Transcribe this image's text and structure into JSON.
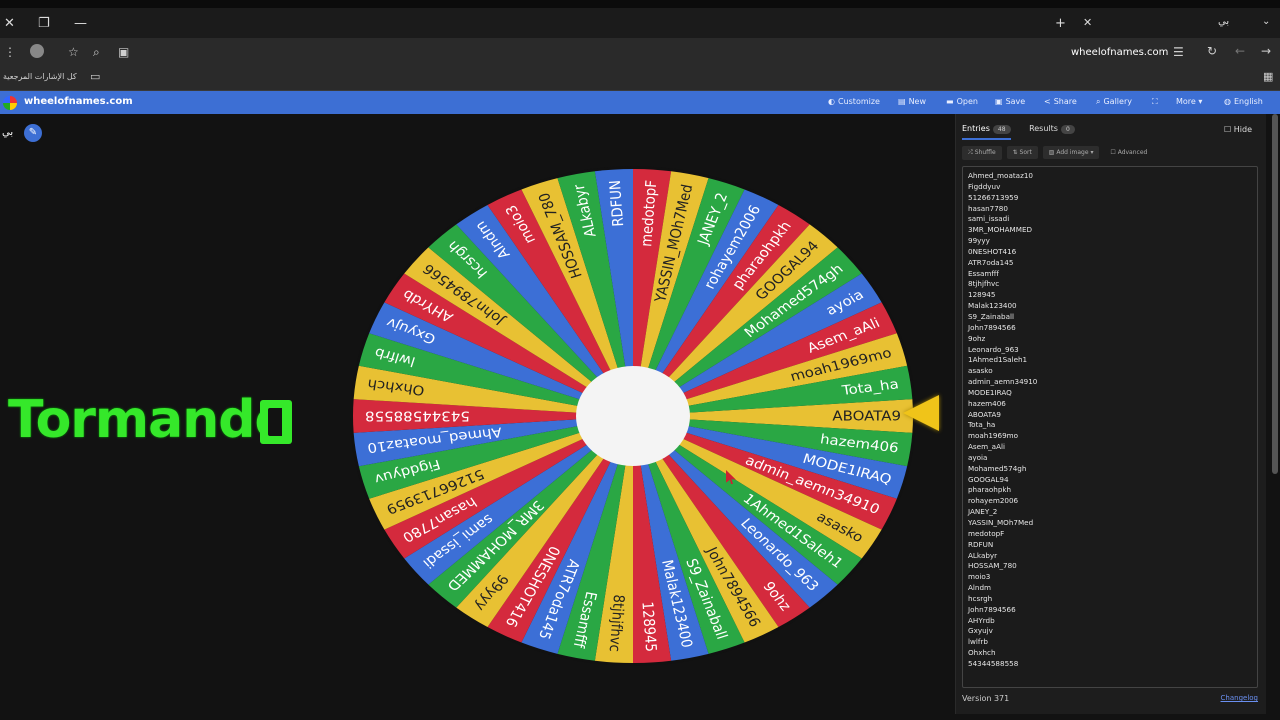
{
  "browser": {
    "url": "wheelofnames.com",
    "tab_title": "بي",
    "bookmarks_label": "كل الإشارات المرجعية"
  },
  "app": {
    "site": "wheelofnames.com",
    "title": "بي",
    "menu": [
      "Customize",
      "New",
      "Open",
      "Save",
      "Share",
      "Gallery",
      "More",
      "English"
    ]
  },
  "overlay": {
    "text": "Tormando"
  },
  "sidebar": {
    "tab_entries": "Entries",
    "entries_count": "48",
    "tab_results": "Results",
    "results_count": "0",
    "hide": "Hide",
    "shuffle": "Shuffle",
    "sort": "Sort",
    "add_image": "Add image",
    "advanced": "Advanced",
    "version": "Version 371",
    "changelog": "Changelog"
  },
  "entries": [
    "Ahmed_moataz10",
    "Figddyuv",
    "51266713959",
    "hasan7780",
    "sami_issadi",
    "3MR_MOHAMMED",
    "99yyy",
    "0NESHOT416",
    "ATR7oda145",
    "Essamfff",
    "8tjhjfhvc",
    "128945",
    "Malak123400",
    "S9_Zainaball",
    "John7894566",
    "9ohz",
    "Leonardo_963",
    "1Ahmed1Saleh1",
    "asasko",
    "admin_aemn34910",
    "MODE1IRAQ",
    "hazem406",
    "ABOATA9",
    "Tota_ha",
    "moah1969mo",
    "Asem_aAli",
    "ayoia",
    "Mohamed574gh",
    "GOOGAL94",
    "pharaohpkh",
    "rohayem2006",
    "JANEY_2",
    "YASSIN_MOh7Med",
    "medotopF",
    "RDFUN",
    "ALkabyr",
    "HOSSAM_780",
    "moio3",
    "Alndm",
    "hcsrgh",
    "John7894566",
    "AHYrdb",
    "Gxyujv",
    "lwlfrb",
    "Ohxhch",
    "54344588558"
  ],
  "wheel": {
    "colors": [
      "#e8c133",
      "#2aa744",
      "#3c6fd6",
      "#d42a3d"
    ],
    "labels": [
      "ABOATA9",
      "hazem406",
      "MODE1IRAQ",
      "admin_aemn34910",
      "asasko",
      "1Ahmed1Saleh1",
      "Leonardo_963",
      "9ohz",
      "John7894566",
      "S9_Zainaball",
      "Malak123400",
      "128945",
      "8tjhjfhvc",
      "Essamfff",
      "ATR7oda145",
      "0NESHOT416",
      "99yyy",
      "3MR_MOHAMMED",
      "sami_issadi",
      "hasan7780",
      "51266713959",
      "Figddyuv",
      "Ahmed_moataz10",
      "54344588558",
      "Ohxhch",
      "lwlfrb",
      "Gxyujv",
      "AHYrdb",
      "John7894566",
      "hcsrgh",
      "Alndm",
      "moio3",
      "HOSSAM_780",
      "ALkabyr",
      "RDFUN",
      "medotopF",
      "YASSIN_MOh7Med",
      "JANEY_2",
      "rohayem2006",
      "pharaohpkh",
      "GOOGAL94",
      "Mohamed574gh",
      "ayoia",
      "Asem_aAli",
      "moah1969mo",
      "Tota_ha"
    ]
  }
}
